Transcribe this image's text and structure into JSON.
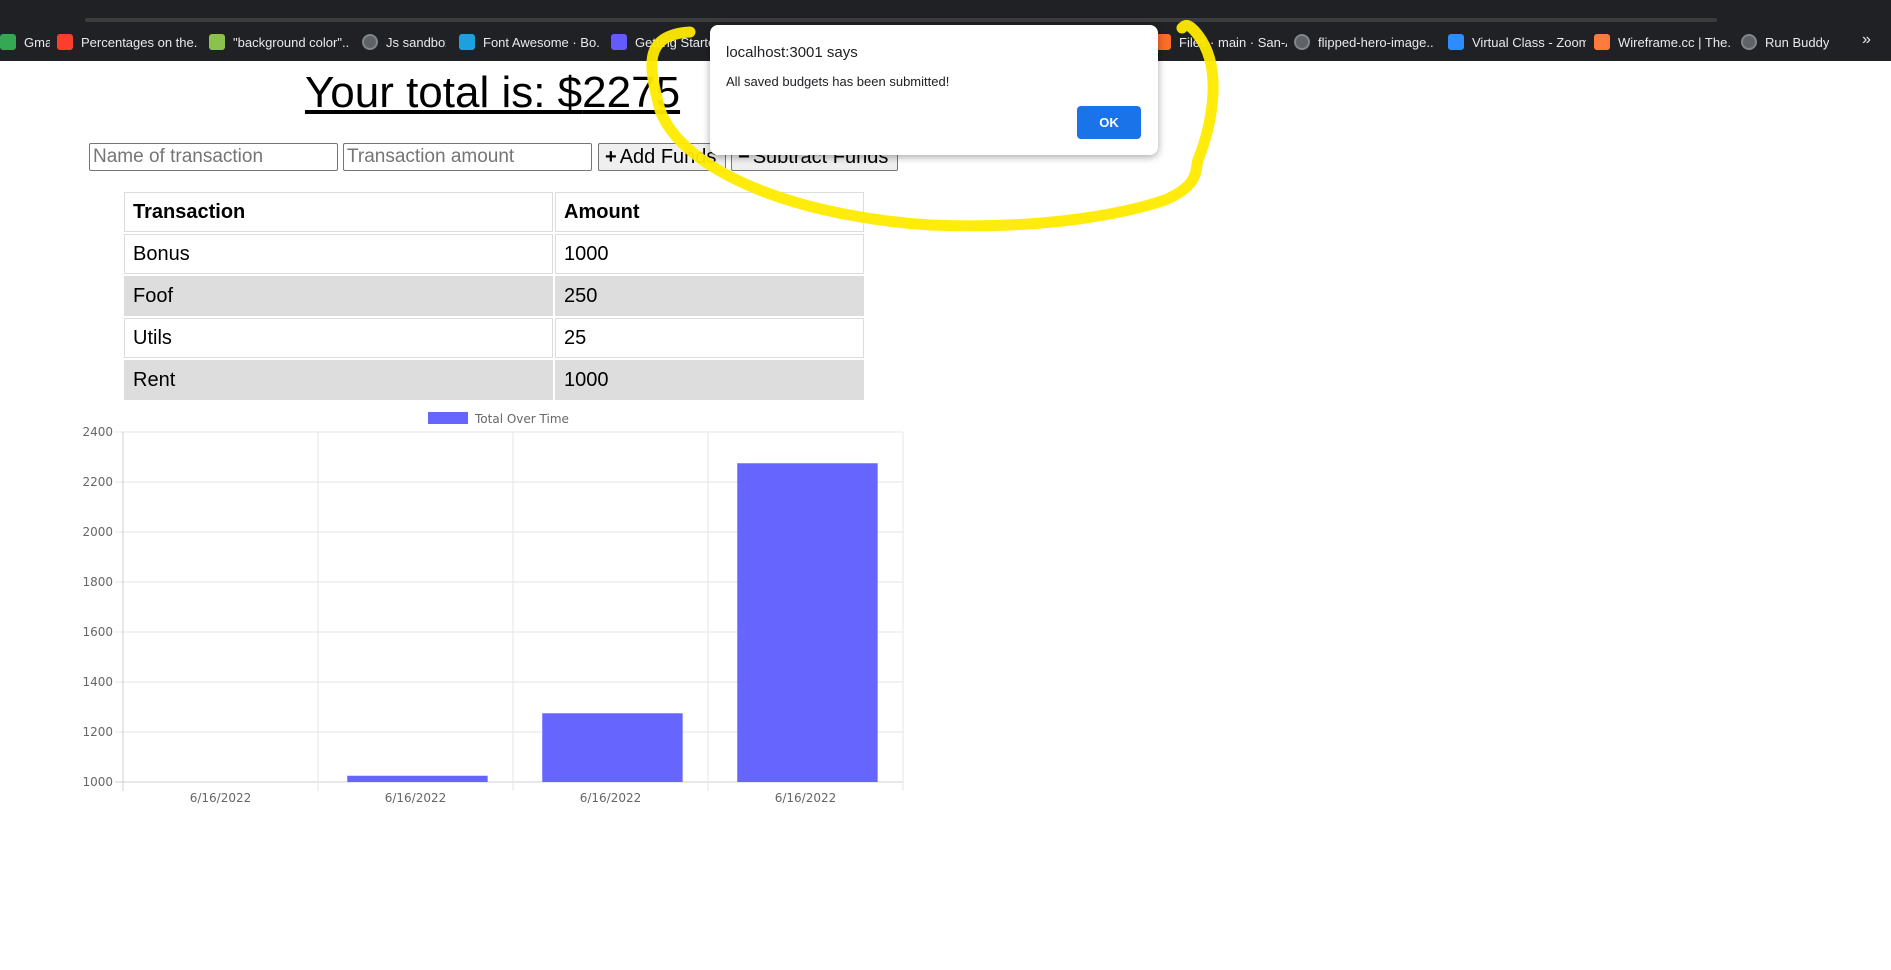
{
  "bookmarks": [
    {
      "label": "Gmail",
      "icon": "gmail-icon",
      "color": "#34a853"
    },
    {
      "label": "Percentages on the...",
      "icon": "khan-academy-icon",
      "color": "#ff3d2e"
    },
    {
      "label": "\"background color\"...",
      "icon": "image-icon",
      "color": "#8bc34a"
    },
    {
      "label": "Js sandbox",
      "icon": "globe-icon",
      "color": "#5f6368"
    },
    {
      "label": "Font Awesome · Bo...",
      "icon": "bootstrap-icon",
      "color": "#1ba1e2"
    },
    {
      "label": "Getting Started",
      "icon": "stripe-icon",
      "color": "#635bff"
    },
    {
      "label": "Files · main · San-A...",
      "icon": "gitlab-icon",
      "color": "#fc6d26"
    },
    {
      "label": "flipped-hero-image...",
      "icon": "globe-icon",
      "color": "#5f6368"
    },
    {
      "label": "Virtual Class - Zoom",
      "icon": "zoom-icon",
      "color": "#2d8cff"
    },
    {
      "label": "Wireframe.cc | The...",
      "icon": "wireframe-icon",
      "color": "#ff7a3d"
    },
    {
      "label": "Run Buddy",
      "icon": "globe-icon",
      "color": "#5f6368"
    }
  ],
  "bookmarks_more": "»",
  "total": {
    "label": "Your total is: $",
    "value": "2275"
  },
  "form": {
    "name_placeholder": "Name of transaction",
    "amount_placeholder": "Transaction amount",
    "add_label": "Add Funds",
    "add_glyph": "+",
    "subtract_label": "Subtract Funds",
    "subtract_glyph": "−"
  },
  "table": {
    "headers": [
      "Transaction",
      "Amount"
    ],
    "rows": [
      [
        "Bonus",
        "1000"
      ],
      [
        "Foof",
        "250"
      ],
      [
        "Utils",
        "25"
      ],
      [
        "Rent",
        "1000"
      ]
    ]
  },
  "chart_data": {
    "type": "bar",
    "categories": [
      "6/16/2022",
      "6/16/2022",
      "6/16/2022",
      "6/16/2022"
    ],
    "series": [
      {
        "name": "Total Over Time",
        "values": [
          1000,
          1025,
          1275,
          2275
        ]
      }
    ],
    "ylim": [
      1000,
      2400
    ],
    "yticks": [
      1000,
      1200,
      1400,
      1600,
      1800,
      2000,
      2200,
      2400
    ],
    "legend": "top",
    "grid": true,
    "bar_color": "#6666ff"
  },
  "dialog": {
    "title": "localhost:3001 says",
    "message": "All saved budgets has been submitted!",
    "ok_label": "OK"
  },
  "colors": {
    "highlight": "#ffeb00",
    "dialog_button": "#1a73e8",
    "toolbar_bg": "#202124"
  }
}
